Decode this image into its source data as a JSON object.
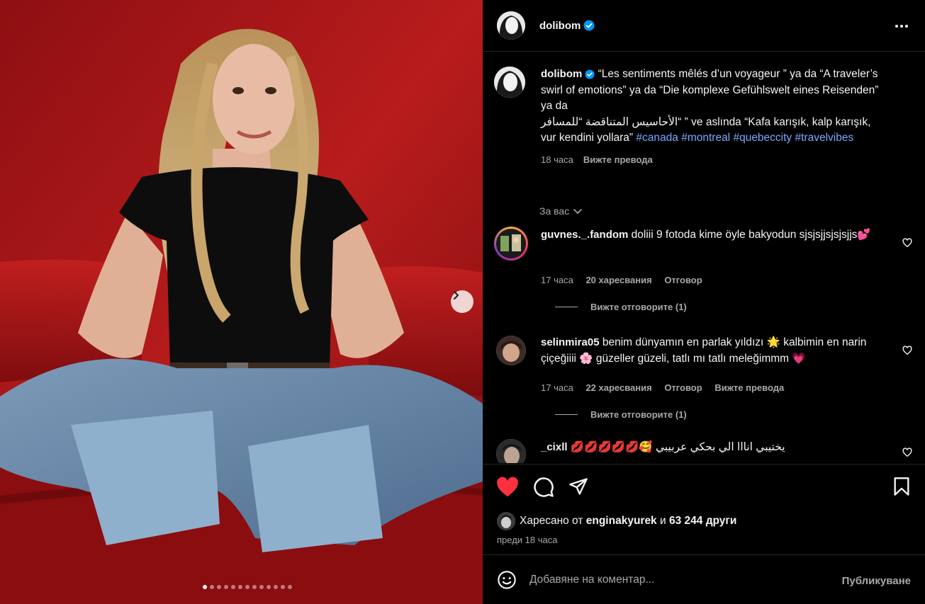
{
  "post": {
    "username": "dolibom",
    "carousel": {
      "count": 13,
      "active": 0
    }
  },
  "header": {
    "username": "dolibom"
  },
  "caption": {
    "username": "dolibom",
    "text_1": "“Les sentiments mêlés d’un voyageur ” ya da “A traveler’s swirl of emotions” ya da “Die komplexe Gefühlswelt eines Reisenden” ya da",
    "text_rtl": "“الأحاسيس المتناقضة “للمسافر",
    "text_2": " ” ve aslında “Kafa karışık, kalp karışık, vur kendini yollara” ",
    "hashtags": [
      "#canada",
      "#montreal",
      "#quebeccity",
      "#travelvibes"
    ],
    "time": "18 часа",
    "translate": "Вижте превода"
  },
  "filter": {
    "label": "За вас"
  },
  "comments": [
    {
      "username": "guvnes._.fandom",
      "text": "doliii 9 fotoda kime öyle bakyodun sjsjsjjsjsjsjjs💕",
      "time": "17 часа",
      "likes": "20 харесвания",
      "reply": "Отговор",
      "view_replies": "Вижте отговорите (1)"
    },
    {
      "username": "selinmira05",
      "text": "benim dünyamın en parlak yıldızı 🌟 kalbimin en narin çiçeğiiii 🌸 güzeller güzeli, tatlı mı tatlı meleğimmm 💗",
      "time": "17 часа",
      "likes": "22 харесвания",
      "reply": "Отговор",
      "translate": "Вижте превода",
      "view_replies": "Вижте отговорите (1)"
    },
    {
      "username": "_cixll",
      "text": "💋💋💋💋💋🥰 يختيبي انااا الي بحكي عربيبي"
    }
  ],
  "likes": {
    "prefix": "Харесано от",
    "user": "enginakyurek",
    "and": "и",
    "others": "63 244 други"
  },
  "date": "преди 18 часа",
  "comment_box": {
    "placeholder": "Добавяне на коментар...",
    "publish": "Публикуване"
  },
  "colors": {
    "liked_heart": "#ff3040",
    "hashtag": "#7ba8ff",
    "verified": "#0095f6"
  }
}
